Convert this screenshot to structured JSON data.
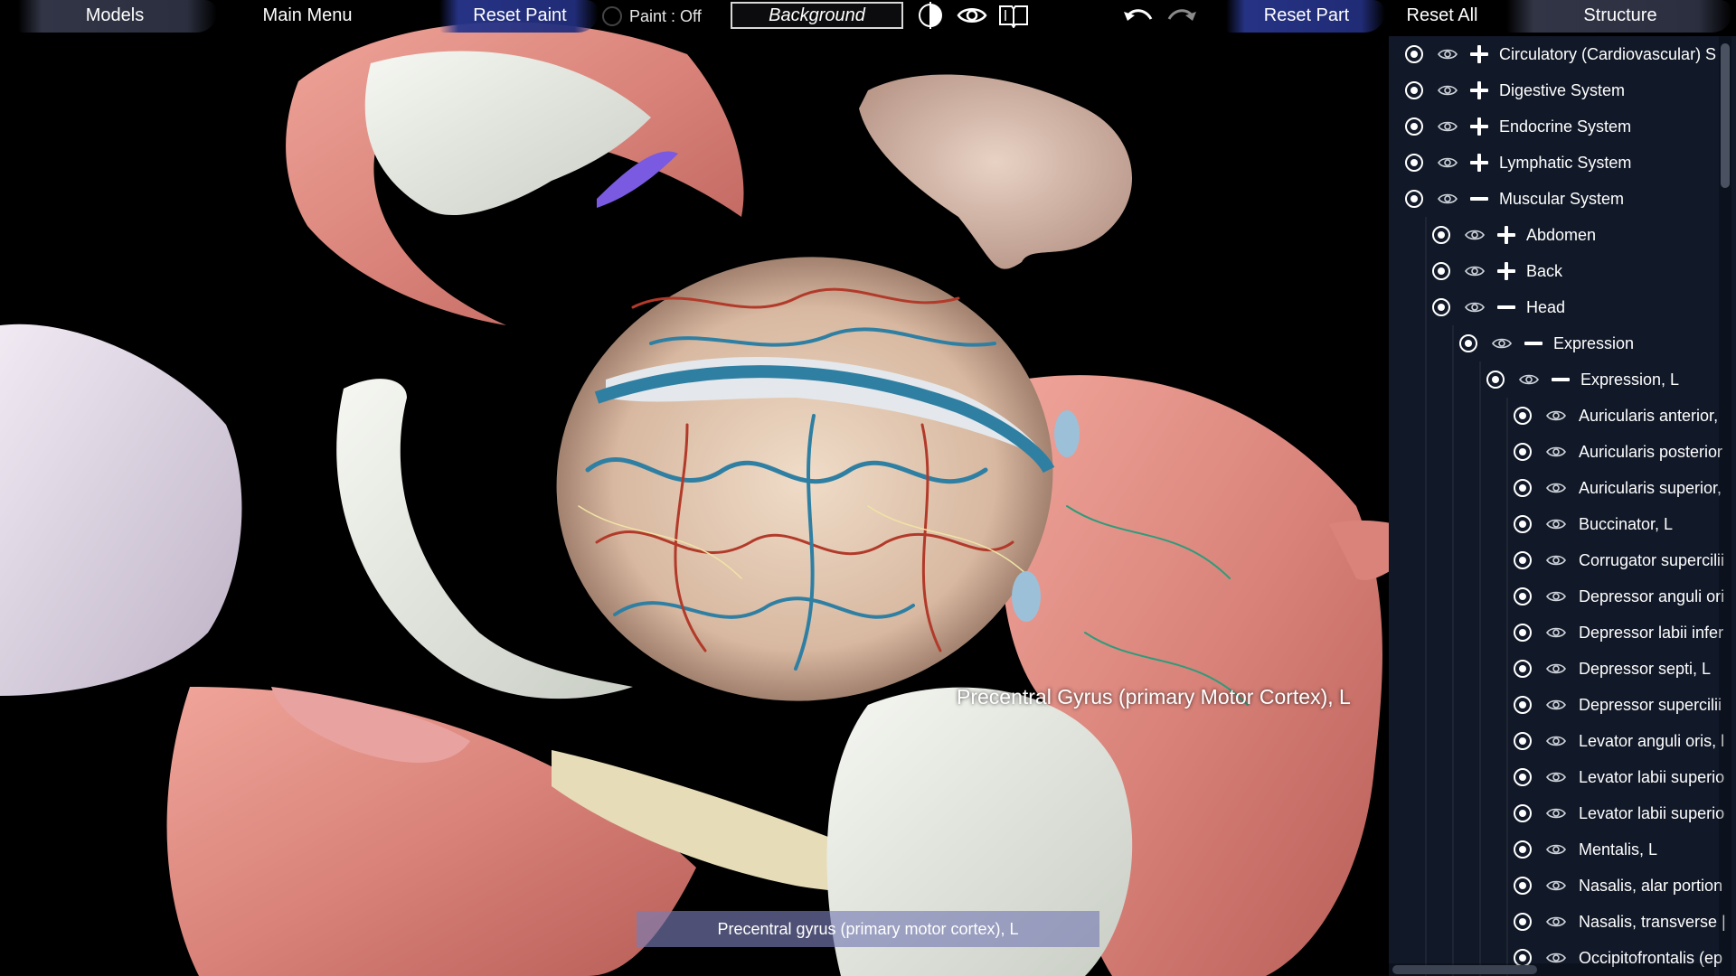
{
  "toolbar": {
    "models": "Models",
    "main_menu": "Main Menu",
    "reset_paint": "Reset Paint",
    "paint_status": "Paint : Off",
    "background": "Background",
    "reset_part": "Reset Part",
    "reset_all": "Reset All",
    "structure": "Structure",
    "icons": {
      "contrast": "contrast-icon",
      "visibility": "eye-icon",
      "book": "book-icon",
      "undo": "undo-icon",
      "redo": "redo-icon"
    }
  },
  "viewport": {
    "hover_label": "Precentral Gyrus (primary Motor Cortex), L",
    "selected_part": "Precentral gyrus (primary motor cortex), L"
  },
  "structure_panel": {
    "items": [
      {
        "label": "Circulatory (Cardiovascular) S",
        "level": 0,
        "expander": "plus"
      },
      {
        "label": "Digestive System",
        "level": 0,
        "expander": "plus"
      },
      {
        "label": "Endocrine System",
        "level": 0,
        "expander": "plus"
      },
      {
        "label": "Lymphatic System",
        "level": 0,
        "expander": "plus"
      },
      {
        "label": "Muscular System",
        "level": 0,
        "expander": "minus"
      },
      {
        "label": "Abdomen",
        "level": 1,
        "expander": "plus"
      },
      {
        "label": "Back",
        "level": 1,
        "expander": "plus"
      },
      {
        "label": "Head",
        "level": 1,
        "expander": "minus"
      },
      {
        "label": "Expression",
        "level": 2,
        "expander": "minus"
      },
      {
        "label": "Expression, L",
        "level": 3,
        "expander": "minus"
      },
      {
        "label": "Auricularis anterior,",
        "level": 4,
        "expander": "none"
      },
      {
        "label": "Auricularis posterior",
        "level": 4,
        "expander": "none"
      },
      {
        "label": "Auricularis superior,",
        "level": 4,
        "expander": "none"
      },
      {
        "label": "Buccinator, L",
        "level": 4,
        "expander": "none"
      },
      {
        "label": "Corrugator supercilii",
        "level": 4,
        "expander": "none"
      },
      {
        "label": "Depressor anguli ori",
        "level": 4,
        "expander": "none"
      },
      {
        "label": "Depressor labii infer",
        "level": 4,
        "expander": "none"
      },
      {
        "label": "Depressor septi, L",
        "level": 4,
        "expander": "none"
      },
      {
        "label": "Depressor supercilii",
        "level": 4,
        "expander": "none"
      },
      {
        "label": "Levator anguli oris, l",
        "level": 4,
        "expander": "none"
      },
      {
        "label": "Levator labii superio",
        "level": 4,
        "expander": "none"
      },
      {
        "label": "Levator labii superio",
        "level": 4,
        "expander": "none"
      },
      {
        "label": "Mentalis, L",
        "level": 4,
        "expander": "none"
      },
      {
        "label": "Nasalis, alar portion",
        "level": 4,
        "expander": "none"
      },
      {
        "label": "Nasalis, transverse |",
        "level": 4,
        "expander": "none"
      },
      {
        "label": "Occipitofrontalis (ep",
        "level": 4,
        "expander": "none"
      }
    ]
  },
  "colors": {
    "panel_bg": "#111827",
    "toolbar_brush": "#34384a",
    "toolbar_brush_active": "#28368c",
    "selected_bar": "#787cb4",
    "muscle": "#d9837a",
    "bone": "#e9ece6",
    "vein": "#2f7fa3",
    "artery": "#b23a2a",
    "nerve": "#f0e3a6"
  }
}
